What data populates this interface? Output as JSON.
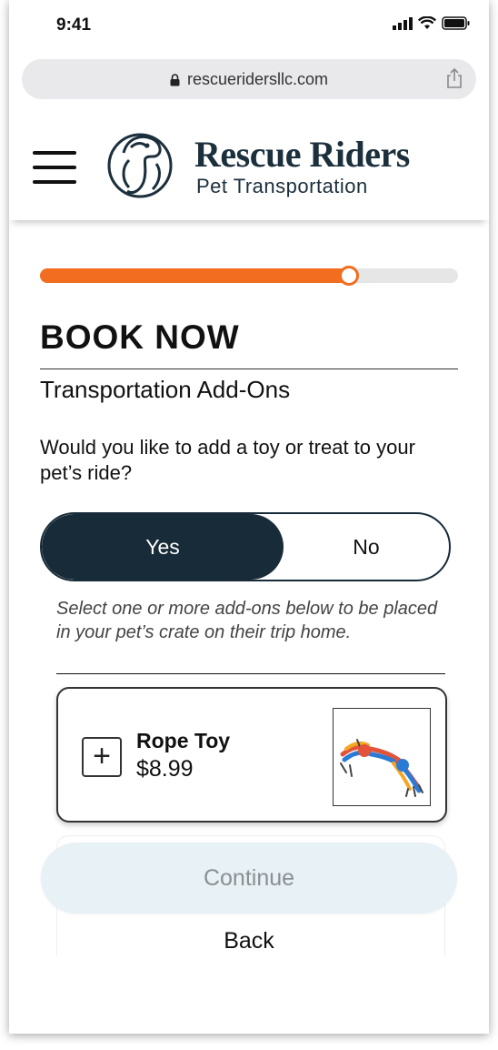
{
  "status_bar": {
    "time": "9:41"
  },
  "browser": {
    "url": "rescueridersllc.com"
  },
  "header": {
    "brand_name": "Rescue Riders",
    "tagline": "Pet Transportation"
  },
  "progress": {
    "fraction": 0.74
  },
  "booking": {
    "title": "BOOK NOW",
    "section_title": "Transportation Add-Ons",
    "question": "Would you like to add a toy or treat to your pet’s ride?",
    "toggle": {
      "yes_label": "Yes",
      "no_label": "No",
      "selected": "Yes"
    },
    "hint": "Select one or more add-ons below to be placed in your pet’s crate on their trip home.",
    "addons": [
      {
        "name": "Rope Toy",
        "price": "$8.99",
        "add_symbol": "+"
      }
    ],
    "continue_label": "Continue",
    "back_label": "Back"
  },
  "colors": {
    "accent": "#f26d1f",
    "brand_dark": "#172b38",
    "continue_bg": "#e8f1f5"
  }
}
